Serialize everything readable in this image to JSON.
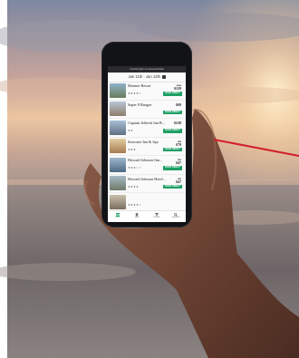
{
  "phone": {
    "url_bar": "hoteltonight.com/search/bali",
    "date_range": "Jan 11th - Jan 12th",
    "book_label": "BOOK DIRECT",
    "hotels": [
      {
        "name": "Mariner Resort",
        "stars": "★★★★☆",
        "old_price": "$155",
        "price": "$129"
      },
      {
        "name": "Super 8 Bangor",
        "stars": "",
        "old_price": "",
        "price": "$69"
      },
      {
        "name": "Captain Jefferds Inn B...",
        "stars": "★★",
        "old_price": "",
        "price": "$238"
      },
      {
        "name": "Seawater Inn & Spa",
        "stars": "★★★",
        "old_price": "$99",
        "price": "$79"
      },
      {
        "name": "Howard Johnson Inn...",
        "stars": "★★★☆☆",
        "old_price": "$56",
        "price": "$47"
      },
      {
        "name": "Howard Johnson Hotel...",
        "stars": "★★★★",
        "old_price": "$56",
        "price": "$47"
      },
      {
        "name": "",
        "stars": "★★★★☆",
        "old_price": "",
        "price": ""
      }
    ],
    "tabs": [
      {
        "label": "LIST",
        "icon": "list-icon"
      },
      {
        "label": "MAP",
        "icon": "map-pin-icon"
      },
      {
        "label": "FILTER",
        "icon": "filter-icon"
      },
      {
        "label": "SEARCH",
        "icon": "search-icon"
      }
    ]
  },
  "colors": {
    "accent_green": "#1f9f65",
    "annotation_line": "#d21e2c"
  }
}
